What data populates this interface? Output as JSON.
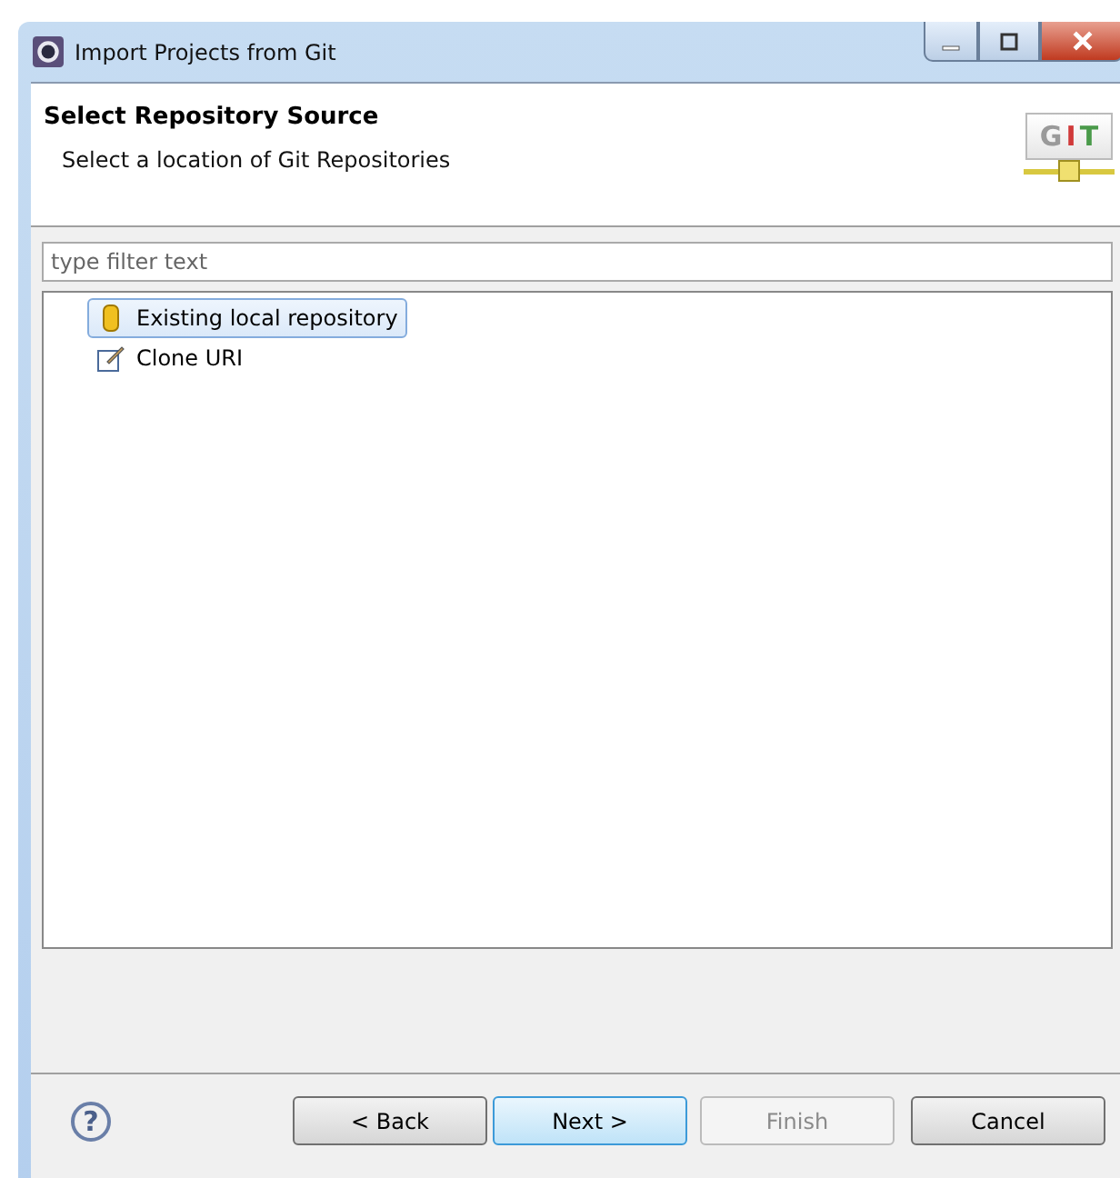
{
  "window": {
    "title": "Import Projects from Git"
  },
  "header": {
    "title": "Select Repository Source",
    "description": "Select a location of Git Repositories",
    "logo": "GIT"
  },
  "filter": {
    "placeholder": "type filter text"
  },
  "tree": [
    {
      "label": "Existing local repository",
      "kind": "repository",
      "selected": true
    },
    {
      "label": "Clone URI",
      "kind": "clone",
      "selected": false
    }
  ],
  "help": "?",
  "buttons": [
    {
      "label": "< Back",
      "disabled": false,
      "default": false
    },
    {
      "label": "Next >",
      "disabled": false,
      "default": true
    },
    {
      "label": "Finish",
      "disabled": true,
      "default": false
    },
    {
      "label": "Cancel",
      "disabled": false,
      "default": false
    }
  ]
}
